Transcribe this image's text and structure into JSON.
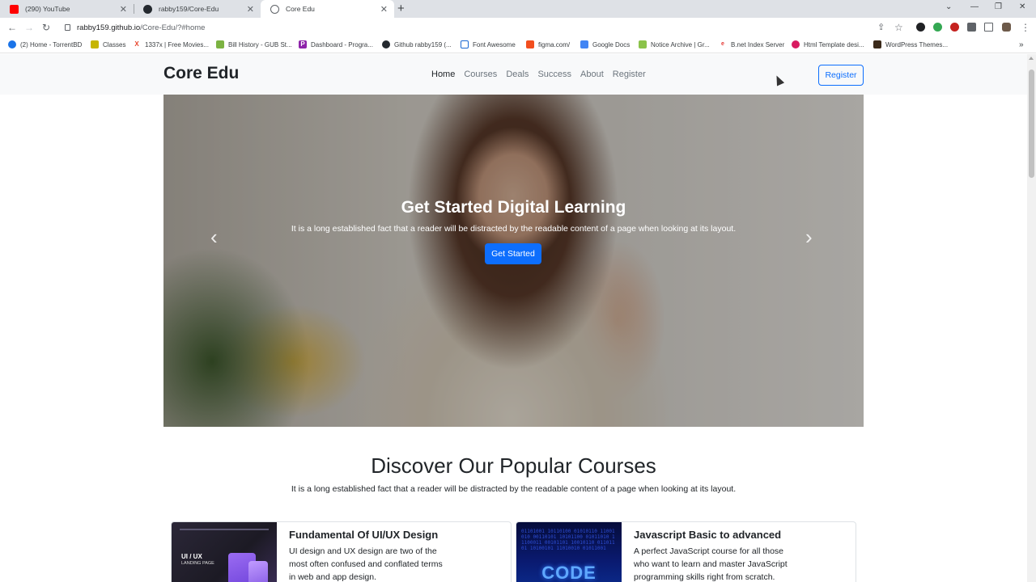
{
  "browser": {
    "tabs": [
      {
        "title": "(290) YouTube",
        "icon": "youtube-icon",
        "color": "#ff0000"
      },
      {
        "title": "rabby159/Core-Edu",
        "icon": "github-icon",
        "color": "#24292f"
      },
      {
        "title": "Core Edu",
        "icon": "globe-icon",
        "color": "#5f6368"
      }
    ],
    "url_host": "rabby159.github.io",
    "url_path": "/Core-Edu/?#home",
    "bookmarks": [
      {
        "label": "(2) Home - TorrentBD",
        "icon": "torrentbd-icon",
        "color": "#1a73e8",
        "glyph": ""
      },
      {
        "label": "Classes",
        "icon": "classroom-icon",
        "color": "#c6b500",
        "glyph": ""
      },
      {
        "label": "1337x | Free Movies...",
        "icon": "x-icon",
        "color": "#e8452c",
        "glyph": "X"
      },
      {
        "label": "Bill History - GUB St...",
        "icon": "gub-icon",
        "color": "#7cb342",
        "glyph": ""
      },
      {
        "label": "Dashboard - Progra...",
        "icon": "programming-hero-icon",
        "color": "#8e24aa",
        "glyph": "P"
      },
      {
        "label": "Github rabby159 (...",
        "icon": "github-icon",
        "color": "#24292f",
        "glyph": ""
      },
      {
        "label": "Font Awesome",
        "icon": "flag-icon",
        "color": "#1967d2",
        "glyph": ""
      },
      {
        "label": "figma.com/",
        "icon": "figma-icon",
        "color": "#f24e1e",
        "glyph": ""
      },
      {
        "label": "Google Docs",
        "icon": "docs-icon",
        "color": "#4285f4",
        "glyph": ""
      },
      {
        "label": "Notice Archive | Gr...",
        "icon": "notice-icon",
        "color": "#8bc34a",
        "glyph": ""
      },
      {
        "label": "B.net Index Server",
        "icon": "bnet-icon",
        "color": "#e53935",
        "glyph": ""
      },
      {
        "label": "Html Template desi...",
        "icon": "template-icon",
        "color": "#d81b60",
        "glyph": ""
      },
      {
        "label": "WordPress Themes...",
        "icon": "wordpress-icon",
        "color": "#3b2a1a",
        "glyph": ""
      }
    ]
  },
  "site": {
    "brand": "Core Edu",
    "nav": [
      "Home",
      "Courses",
      "Deals",
      "Success",
      "About",
      "Register"
    ],
    "register_button": "Register",
    "hero": {
      "title": "Get Started Digital Learning",
      "text": "It is a long established fact that a reader will be distracted by the readable content of a page when looking at its layout.",
      "button": "Get Started",
      "prev": "‹",
      "next": "›"
    },
    "section": {
      "title": "Discover Our Popular Courses",
      "subtitle": "It is a long established fact that a reader will be distracted by the readable content of a page when looking at its layout."
    },
    "courses": [
      {
        "title": "Fundamental Of UI/UX Design",
        "text": "UI design and UX design are two of the most often confused and conflated terms in web and app design.",
        "image_label": "UI / UX",
        "image_sublabel": "LANDING PAGE"
      },
      {
        "title": "Javascript Basic to advanced",
        "text": "A perfect JavaScript course for all those who want to learn and master JavaScript programming skills right from scratch.",
        "image_label": "CODE",
        "image_bits": "01101001 10110100 01010110 11001010 00110101 10101100 01011010 11100011 00101101 10010110 01101101 10100101 11010010 01011001"
      }
    ]
  },
  "colors": {
    "primary": "#0d6efd",
    "nav_bg": "#f8f9fa"
  }
}
